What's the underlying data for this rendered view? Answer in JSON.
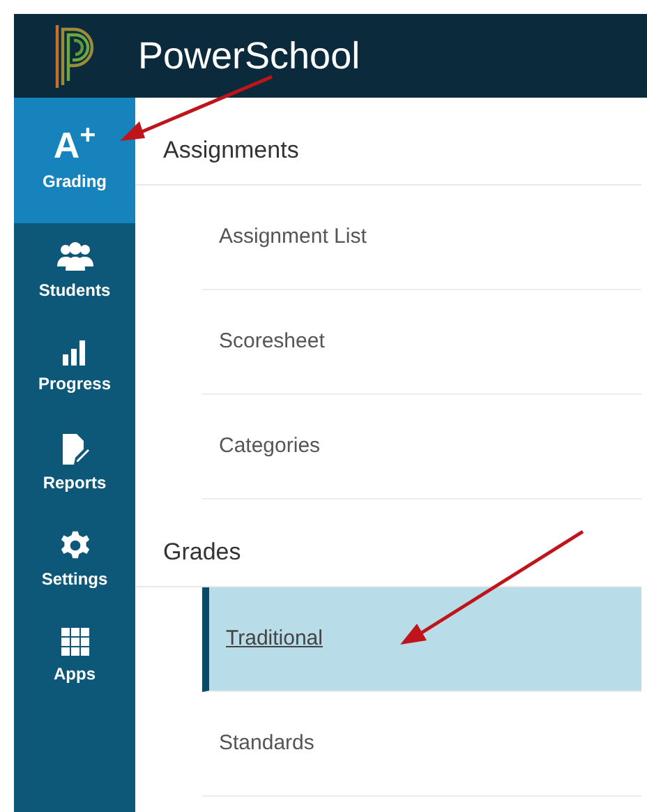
{
  "header": {
    "title": "PowerSchool"
  },
  "nav": [
    {
      "label": "Grading",
      "kind": "grade",
      "glyph": "A$^{+}$",
      "selected": true
    },
    {
      "label": "Students",
      "kind": "people",
      "selected": false
    },
    {
      "label": "Progress",
      "kind": "chart",
      "selected": false
    },
    {
      "label": "Reports",
      "kind": "report",
      "selected": false
    },
    {
      "label": "Settings",
      "kind": "gear",
      "selected": false
    },
    {
      "label": "Apps",
      "kind": "grid",
      "selected": false
    }
  ],
  "sections": [
    {
      "title": "Assignments",
      "items": [
        {
          "label": "Assignment List",
          "selected": false
        },
        {
          "label": "Scoresheet",
          "selected": false
        },
        {
          "label": "Categories",
          "selected": false
        }
      ]
    },
    {
      "title": "Grades",
      "items": [
        {
          "label": "Traditional",
          "selected": true
        },
        {
          "label": "Standards",
          "selected": false
        }
      ]
    }
  ]
}
